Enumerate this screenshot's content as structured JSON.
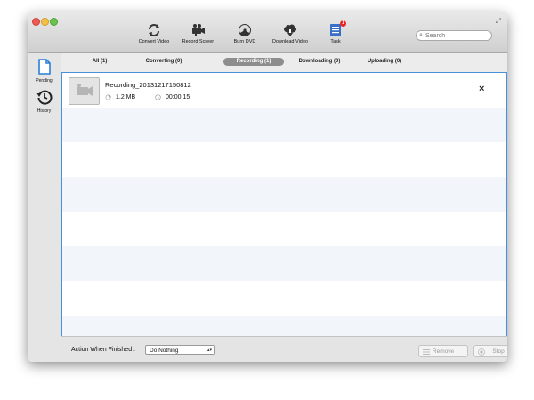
{
  "toolbar": {
    "items": [
      {
        "label": "Convert Video",
        "icon": "convert-icon"
      },
      {
        "label": "Record Screen",
        "icon": "camera-icon"
      },
      {
        "label": "Burn DVD",
        "icon": "radiation-icon"
      },
      {
        "label": "Download Video",
        "icon": "cloud-download-icon"
      },
      {
        "label": "Task",
        "icon": "task-icon",
        "badge": "1"
      }
    ],
    "search_placeholder": "Search"
  },
  "sidebar": {
    "items": [
      {
        "label": "Pending",
        "icon": "document-icon"
      },
      {
        "label": "History",
        "icon": "history-icon"
      }
    ]
  },
  "tabs": [
    {
      "label": "All (1)"
    },
    {
      "label": "Converting (0)"
    },
    {
      "label": "Recording (1)",
      "active": true
    },
    {
      "label": "Downloading (0)"
    },
    {
      "label": "Uploading (0)"
    }
  ],
  "task": {
    "title": "Recording_20131217150812",
    "size": "1.2 MB",
    "duration": "00:00:15",
    "close_label": "×"
  },
  "bottom": {
    "action_label": "Action When Finished :",
    "action_value": "Do Nothing",
    "remove_label": "Remove",
    "stop_label": "Stop"
  },
  "colors": {
    "accent": "#4a90d9",
    "active_tab": "#8d8d8d",
    "badge": "#ee2222"
  }
}
